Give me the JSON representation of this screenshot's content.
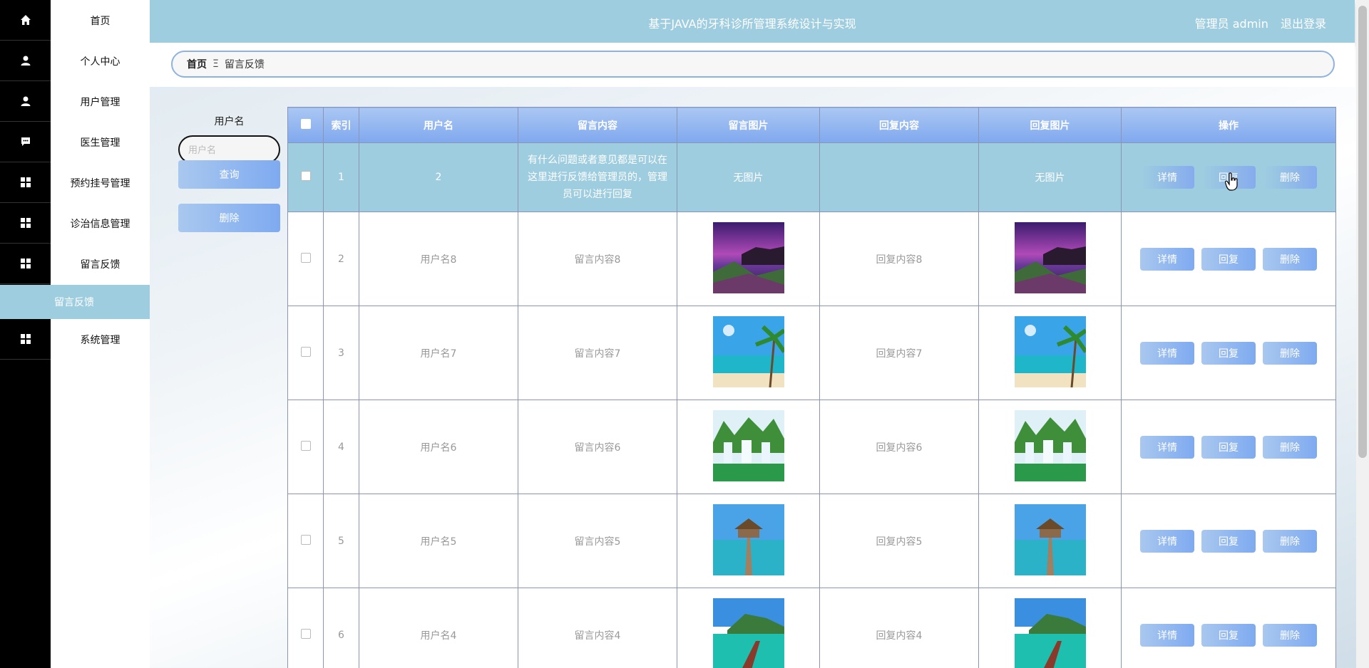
{
  "header": {
    "title": "基于JAVA的牙科诊所管理系统设计与实现",
    "admin": "管理员 admin",
    "logout": "退出登录"
  },
  "sidebar": {
    "items": [
      {
        "label": "首页",
        "icon": "home-icon"
      },
      {
        "label": "个人中心",
        "icon": "user-icon"
      },
      {
        "label": "用户管理",
        "icon": "user-icon"
      },
      {
        "label": "医生管理",
        "icon": "chat-icon"
      },
      {
        "label": "预约挂号管理",
        "icon": "grid-icon"
      },
      {
        "label": "诊治信息管理",
        "icon": "grid-icon"
      },
      {
        "label": "留言反馈",
        "icon": "grid-icon"
      },
      {
        "label": "系统管理",
        "icon": "grid-icon"
      }
    ],
    "sub_item": "留言反馈"
  },
  "breadcrumb": {
    "home": "首页",
    "sep": "Ξ",
    "current": "留言反馈"
  },
  "search": {
    "label": "用户名",
    "placeholder": "用户名",
    "query_button": "查询",
    "delete_button": "删除"
  },
  "table": {
    "headers": [
      "索引",
      "用户名",
      "留言内容",
      "留言图片",
      "回复内容",
      "回复图片",
      "操作"
    ],
    "no_image": "无图片",
    "actions": {
      "detail": "详情",
      "reply": "回复",
      "delete": "删除"
    },
    "rows": [
      {
        "index": "1",
        "username": "2",
        "content": "有什么问题或者意见都是可以在这里进行反馈给管理员的，管理员可以进行回复",
        "reply": ""
      },
      {
        "index": "2",
        "username": "用户名8",
        "content": "留言内容8",
        "reply": "回复内容8",
        "image": "sunset-coast"
      },
      {
        "index": "3",
        "username": "用户名7",
        "content": "留言内容7",
        "reply": "回复内容7",
        "image": "palm-beach"
      },
      {
        "index": "4",
        "username": "用户名6",
        "content": "留言内容6",
        "reply": "回复内容6",
        "image": "waterfall"
      },
      {
        "index": "5",
        "username": "用户名5",
        "content": "留言内容5",
        "reply": "回复内容5",
        "image": "pier-hut"
      },
      {
        "index": "6",
        "username": "用户名4",
        "content": "留言内容4",
        "reply": "回复内容4",
        "image": "island-dock"
      }
    ]
  },
  "colors": {
    "accent": "#9fcde0",
    "button": "#7eaaf0",
    "sidebar_icons_bg": "#000000"
  }
}
